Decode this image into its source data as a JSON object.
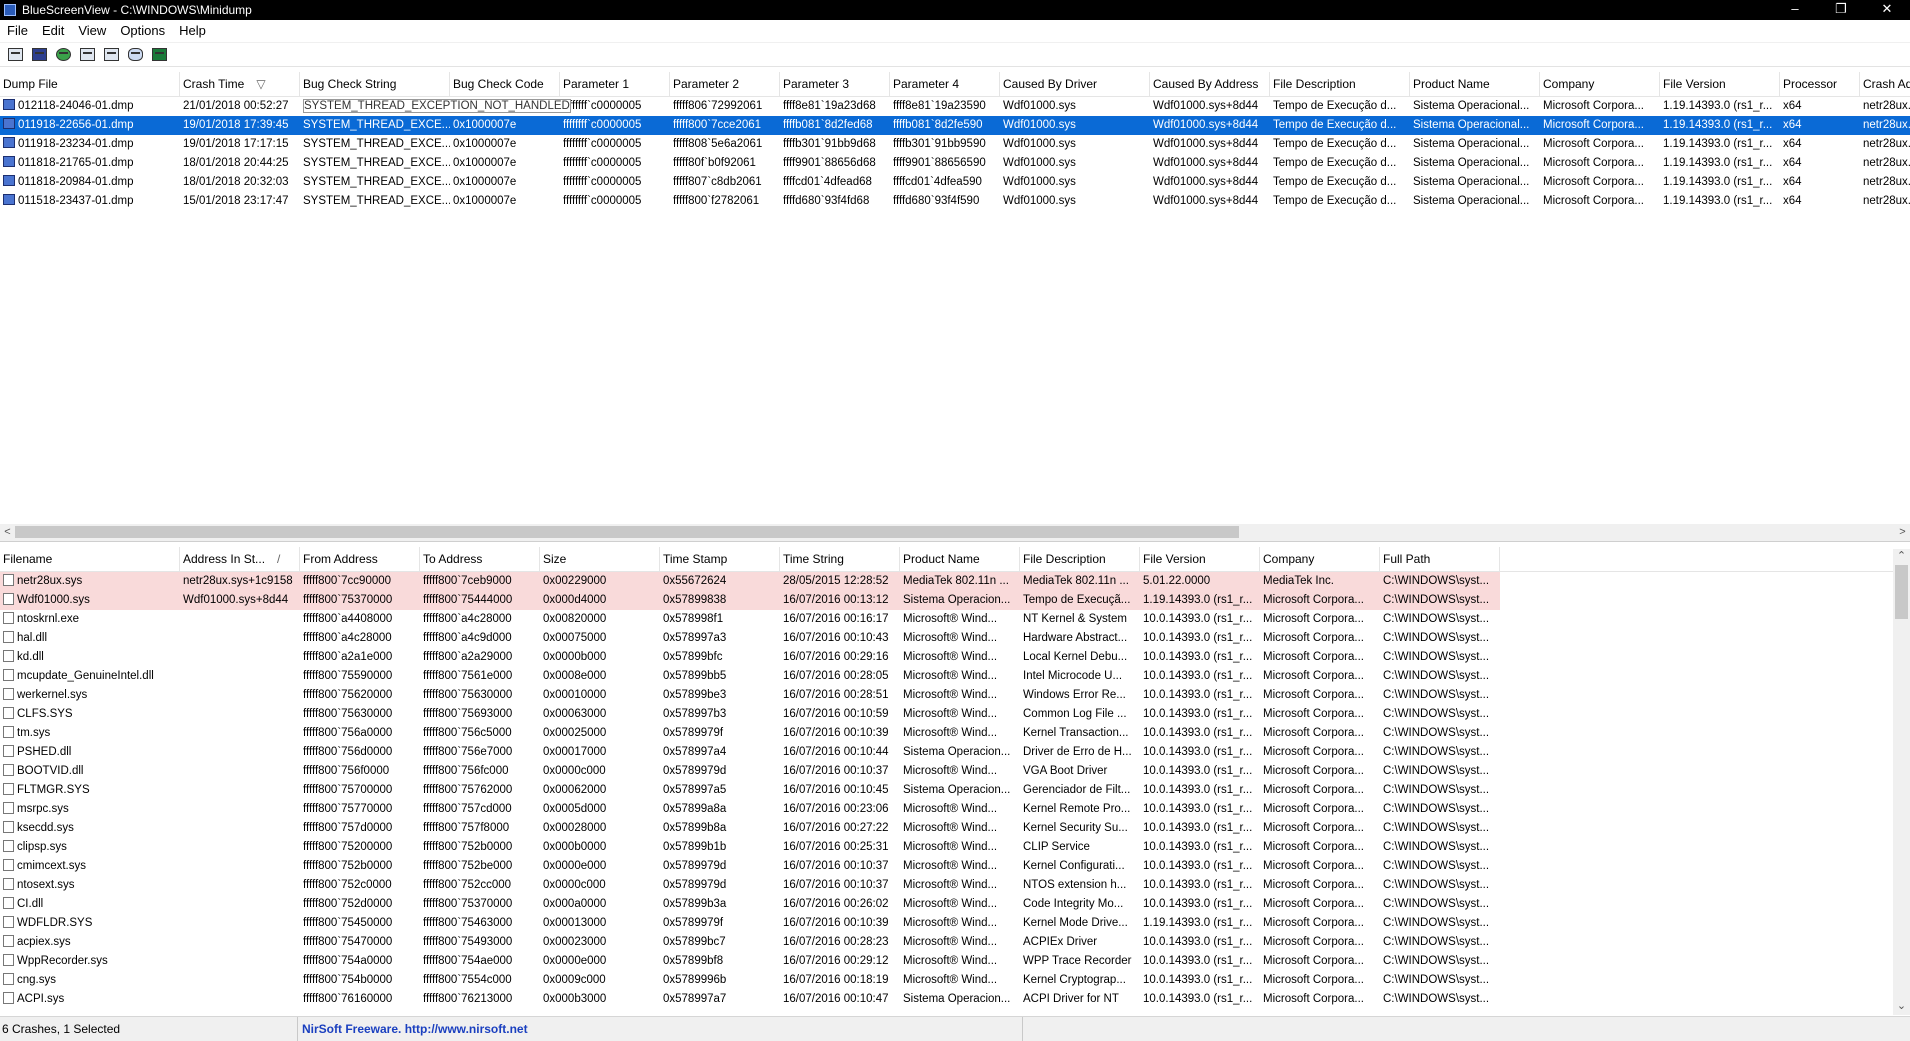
{
  "window": {
    "title": "BlueScreenView - C:\\WINDOWS\\Minidump",
    "min": "–",
    "max": "❐",
    "close": "✕"
  },
  "menu": [
    "File",
    "Edit",
    "View",
    "Options",
    "Help"
  ],
  "toolbar": [
    "properties-icon",
    "save-icon",
    "refresh-icon",
    "copy-icon",
    "options-icon",
    "find-icon",
    "exit-icon"
  ],
  "top_columns": [
    "Dump File",
    "Crash Time",
    "Bug Check String",
    "Bug Check Code",
    "Parameter 1",
    "Parameter 2",
    "Parameter 3",
    "Parameter 4",
    "Caused By Driver",
    "Caused By Address",
    "File Description",
    "Product Name",
    "Company",
    "File Version",
    "Processor",
    "Crash Ad"
  ],
  "crash_time_sort_indicator": "▽",
  "crashes": [
    [
      "012118-24046-01.dmp",
      "21/01/2018 00:52:27",
      "SYSTEM_THREAD_EXCEPTION_NOT_HANDLED",
      "",
      "ffffffff`c0000005",
      "fffff806`72992061",
      "ffff8e81`19a23d68",
      "ffff8e81`19a23590",
      "Wdf01000.sys",
      "Wdf01000.sys+8d44",
      "Tempo de Execução d...",
      "Sistema Operacional...",
      "Microsoft Corpora...",
      "1.19.14393.0 (rs1_r...",
      "x64",
      "netr28ux..."
    ],
    [
      "011918-22656-01.dmp",
      "19/01/2018 17:39:45",
      "SYSTEM_THREAD_EXCE...",
      "0x1000007e",
      "ffffffff`c0000005",
      "fffff800`7cce2061",
      "ffffb081`8d2fed68",
      "ffffb081`8d2fe590",
      "Wdf01000.sys",
      "Wdf01000.sys+8d44",
      "Tempo de Execução d...",
      "Sistema Operacional...",
      "Microsoft Corpora...",
      "1.19.14393.0 (rs1_r...",
      "x64",
      "netr28ux..."
    ],
    [
      "011918-23234-01.dmp",
      "19/01/2018 17:17:15",
      "SYSTEM_THREAD_EXCE...",
      "0x1000007e",
      "ffffffff`c0000005",
      "fffff808`5e6a2061",
      "ffffb301`91bb9d68",
      "ffffb301`91bb9590",
      "Wdf01000.sys",
      "Wdf01000.sys+8d44",
      "Tempo de Execução d...",
      "Sistema Operacional...",
      "Microsoft Corpora...",
      "1.19.14393.0 (rs1_r...",
      "x64",
      "netr28ux..."
    ],
    [
      "011818-21765-01.dmp",
      "18/01/2018 20:44:25",
      "SYSTEM_THREAD_EXCE...",
      "0x1000007e",
      "ffffffff`c0000005",
      "fffff80f`b0f92061",
      "ffff9901`88656d68",
      "ffff9901`88656590",
      "Wdf01000.sys",
      "Wdf01000.sys+8d44",
      "Tempo de Execução d...",
      "Sistema Operacional...",
      "Microsoft Corpora...",
      "1.19.14393.0 (rs1_r...",
      "x64",
      "netr28ux..."
    ],
    [
      "011818-20984-01.dmp",
      "18/01/2018 20:32:03",
      "SYSTEM_THREAD_EXCE...",
      "0x1000007e",
      "ffffffff`c0000005",
      "fffff807`c8db2061",
      "ffffcd01`4dfead68",
      "ffffcd01`4dfea590",
      "Wdf01000.sys",
      "Wdf01000.sys+8d44",
      "Tempo de Execução d...",
      "Sistema Operacional...",
      "Microsoft Corpora...",
      "1.19.14393.0 (rs1_r...",
      "x64",
      "netr28ux..."
    ],
    [
      "011518-23437-01.dmp",
      "15/01/2018 23:17:47",
      "SYSTEM_THREAD_EXCE...",
      "0x1000007e",
      "ffffffff`c0000005",
      "fffff800`f2782061",
      "ffffd680`93f4fd68",
      "ffffd680`93f4f590",
      "Wdf01000.sys",
      "Wdf01000.sys+8d44",
      "Tempo de Execução d...",
      "Sistema Operacional...",
      "Microsoft Corpora...",
      "1.19.14393.0 (rs1_r...",
      "x64",
      "netr28ux..."
    ]
  ],
  "selected_crash_index": 1,
  "bottom_columns": [
    "Filename",
    "Address In St...",
    "From Address",
    "To Address",
    "Size",
    "Time Stamp",
    "Time String",
    "Product Name",
    "File Description",
    "File Version",
    "Company",
    "Full Path"
  ],
  "address_sort_indicator": "/",
  "modules": [
    [
      "netr28ux.sys",
      "netr28ux.sys+1c9158",
      "fffff800`7cc90000",
      "fffff800`7ceb9000",
      "0x00229000",
      "0x55672624",
      "28/05/2015 12:28:52",
      "MediaTek 802.11n ...",
      "MediaTek 802.11n ...",
      "5.01.22.0000",
      "MediaTek Inc.",
      "C:\\WINDOWS\\syst..."
    ],
    [
      "Wdf01000.sys",
      "Wdf01000.sys+8d44",
      "fffff800`75370000",
      "fffff800`75444000",
      "0x000d4000",
      "0x57899838",
      "16/07/2016 00:13:12",
      "Sistema Operacion...",
      "Tempo de Execuçã...",
      "1.19.14393.0 (rs1_r...",
      "Microsoft Corpora...",
      "C:\\WINDOWS\\syst..."
    ],
    [
      "ntoskrnl.exe",
      "",
      "fffff800`a4408000",
      "fffff800`a4c28000",
      "0x00820000",
      "0x578998f1",
      "16/07/2016 00:16:17",
      "Microsoft® Wind...",
      "NT Kernel & System",
      "10.0.14393.0 (rs1_r...",
      "Microsoft Corpora...",
      "C:\\WINDOWS\\syst..."
    ],
    [
      "hal.dll",
      "",
      "fffff800`a4c28000",
      "fffff800`a4c9d000",
      "0x00075000",
      "0x578997a3",
      "16/07/2016 00:10:43",
      "Microsoft® Wind...",
      "Hardware Abstract...",
      "10.0.14393.0 (rs1_r...",
      "Microsoft Corpora...",
      "C:\\WINDOWS\\syst..."
    ],
    [
      "kd.dll",
      "",
      "fffff800`a2a1e000",
      "fffff800`a2a29000",
      "0x0000b000",
      "0x57899bfc",
      "16/07/2016 00:29:16",
      "Microsoft® Wind...",
      "Local Kernel Debu...",
      "10.0.14393.0 (rs1_r...",
      "Microsoft Corpora...",
      "C:\\WINDOWS\\syst..."
    ],
    [
      "mcupdate_GenuineIntel.dll",
      "",
      "fffff800`75590000",
      "fffff800`7561e000",
      "0x0008e000",
      "0x57899bb5",
      "16/07/2016 00:28:05",
      "Microsoft® Wind...",
      "Intel Microcode U...",
      "10.0.14393.0 (rs1_r...",
      "Microsoft Corpora...",
      "C:\\WINDOWS\\syst..."
    ],
    [
      "werkernel.sys",
      "",
      "fffff800`75620000",
      "fffff800`75630000",
      "0x00010000",
      "0x57899be3",
      "16/07/2016 00:28:51",
      "Microsoft® Wind...",
      "Windows Error Re...",
      "10.0.14393.0 (rs1_r...",
      "Microsoft Corpora...",
      "C:\\WINDOWS\\syst..."
    ],
    [
      "CLFS.SYS",
      "",
      "fffff800`75630000",
      "fffff800`75693000",
      "0x00063000",
      "0x578997b3",
      "16/07/2016 00:10:59",
      "Microsoft® Wind...",
      "Common Log File ...",
      "10.0.14393.0 (rs1_r...",
      "Microsoft Corpora...",
      "C:\\WINDOWS\\syst..."
    ],
    [
      "tm.sys",
      "",
      "fffff800`756a0000",
      "fffff800`756c5000",
      "0x00025000",
      "0x5789979f",
      "16/07/2016 00:10:39",
      "Microsoft® Wind...",
      "Kernel Transaction...",
      "10.0.14393.0 (rs1_r...",
      "Microsoft Corpora...",
      "C:\\WINDOWS\\syst..."
    ],
    [
      "PSHED.dll",
      "",
      "fffff800`756d0000",
      "fffff800`756e7000",
      "0x00017000",
      "0x578997a4",
      "16/07/2016 00:10:44",
      "Sistema Operacion...",
      "Driver de Erro de H...",
      "10.0.14393.0 (rs1_r...",
      "Microsoft Corpora...",
      "C:\\WINDOWS\\syst..."
    ],
    [
      "BOOTVID.dll",
      "",
      "fffff800`756f0000",
      "fffff800`756fc000",
      "0x0000c000",
      "0x5789979d",
      "16/07/2016 00:10:37",
      "Microsoft® Wind...",
      "VGA Boot Driver",
      "10.0.14393.0 (rs1_r...",
      "Microsoft Corpora...",
      "C:\\WINDOWS\\syst..."
    ],
    [
      "FLTMGR.SYS",
      "",
      "fffff800`75700000",
      "fffff800`75762000",
      "0x00062000",
      "0x578997a5",
      "16/07/2016 00:10:45",
      "Sistema Operacion...",
      "Gerenciador de Filt...",
      "10.0.14393.0 (rs1_r...",
      "Microsoft Corpora...",
      "C:\\WINDOWS\\syst..."
    ],
    [
      "msrpc.sys",
      "",
      "fffff800`75770000",
      "fffff800`757cd000",
      "0x0005d000",
      "0x57899a8a",
      "16/07/2016 00:23:06",
      "Microsoft® Wind...",
      "Kernel Remote Pro...",
      "10.0.14393.0 (rs1_r...",
      "Microsoft Corpora...",
      "C:\\WINDOWS\\syst..."
    ],
    [
      "ksecdd.sys",
      "",
      "fffff800`757d0000",
      "fffff800`757f8000",
      "0x00028000",
      "0x57899b8a",
      "16/07/2016 00:27:22",
      "Microsoft® Wind...",
      "Kernel Security Su...",
      "10.0.14393.0 (rs1_r...",
      "Microsoft Corpora...",
      "C:\\WINDOWS\\syst..."
    ],
    [
      "clipsp.sys",
      "",
      "fffff800`75200000",
      "fffff800`752b0000",
      "0x000b0000",
      "0x57899b1b",
      "16/07/2016 00:25:31",
      "Microsoft® Wind...",
      "CLIP Service",
      "10.0.14393.0 (rs1_r...",
      "Microsoft Corpora...",
      "C:\\WINDOWS\\syst..."
    ],
    [
      "cmimcext.sys",
      "",
      "fffff800`752b0000",
      "fffff800`752be000",
      "0x0000e000",
      "0x5789979d",
      "16/07/2016 00:10:37",
      "Microsoft® Wind...",
      "Kernel Configurati...",
      "10.0.14393.0 (rs1_r...",
      "Microsoft Corpora...",
      "C:\\WINDOWS\\syst..."
    ],
    [
      "ntosext.sys",
      "",
      "fffff800`752c0000",
      "fffff800`752cc000",
      "0x0000c000",
      "0x5789979d",
      "16/07/2016 00:10:37",
      "Microsoft® Wind...",
      "NTOS extension h...",
      "10.0.14393.0 (rs1_r...",
      "Microsoft Corpora...",
      "C:\\WINDOWS\\syst..."
    ],
    [
      "CI.dll",
      "",
      "fffff800`752d0000",
      "fffff800`75370000",
      "0x000a0000",
      "0x57899b3a",
      "16/07/2016 00:26:02",
      "Microsoft® Wind...",
      "Code Integrity Mo...",
      "10.0.14393.0 (rs1_r...",
      "Microsoft Corpora...",
      "C:\\WINDOWS\\syst..."
    ],
    [
      "WDFLDR.SYS",
      "",
      "fffff800`75450000",
      "fffff800`75463000",
      "0x00013000",
      "0x5789979f",
      "16/07/2016 00:10:39",
      "Microsoft® Wind...",
      "Kernel Mode Drive...",
      "1.19.14393.0 (rs1_r...",
      "Microsoft Corpora...",
      "C:\\WINDOWS\\syst..."
    ],
    [
      "acpiex.sys",
      "",
      "fffff800`75470000",
      "fffff800`75493000",
      "0x00023000",
      "0x57899bc7",
      "16/07/2016 00:28:23",
      "Microsoft® Wind...",
      "ACPIEx Driver",
      "10.0.14393.0 (rs1_r...",
      "Microsoft Corpora...",
      "C:\\WINDOWS\\syst..."
    ],
    [
      "WppRecorder.sys",
      "",
      "fffff800`754a0000",
      "fffff800`754ae000",
      "0x0000e000",
      "0x57899bf8",
      "16/07/2016 00:29:12",
      "Microsoft® Wind...",
      "WPP Trace Recorder",
      "10.0.14393.0 (rs1_r...",
      "Microsoft Corpora...",
      "C:\\WINDOWS\\syst..."
    ],
    [
      "cng.sys",
      "",
      "fffff800`754b0000",
      "fffff800`7554c000",
      "0x0009c000",
      "0x5789996b",
      "16/07/2016 00:18:19",
      "Microsoft® Wind...",
      "Kernel Cryptograp...",
      "10.0.14393.0 (rs1_r...",
      "Microsoft Corpora...",
      "C:\\WINDOWS\\syst..."
    ],
    [
      "ACPI.sys",
      "",
      "fffff800`76160000",
      "fffff800`76213000",
      "0x000b3000",
      "0x578997a7",
      "16/07/2016 00:10:47",
      "Sistema Operacion...",
      "ACPI Driver for NT",
      "10.0.14393.0 (rs1_r...",
      "Microsoft Corpora...",
      "C:\\WINDOWS\\syst..."
    ]
  ],
  "highlighted_module_count": 2,
  "status": {
    "crashes": "6 Crashes, 1 Selected",
    "credit": "NirSoft Freeware.  http://www.nirsoft.net"
  },
  "colors": {
    "selection": "#0a6ad6",
    "highlight": "#f9dada",
    "link": "#1a3fbf"
  }
}
